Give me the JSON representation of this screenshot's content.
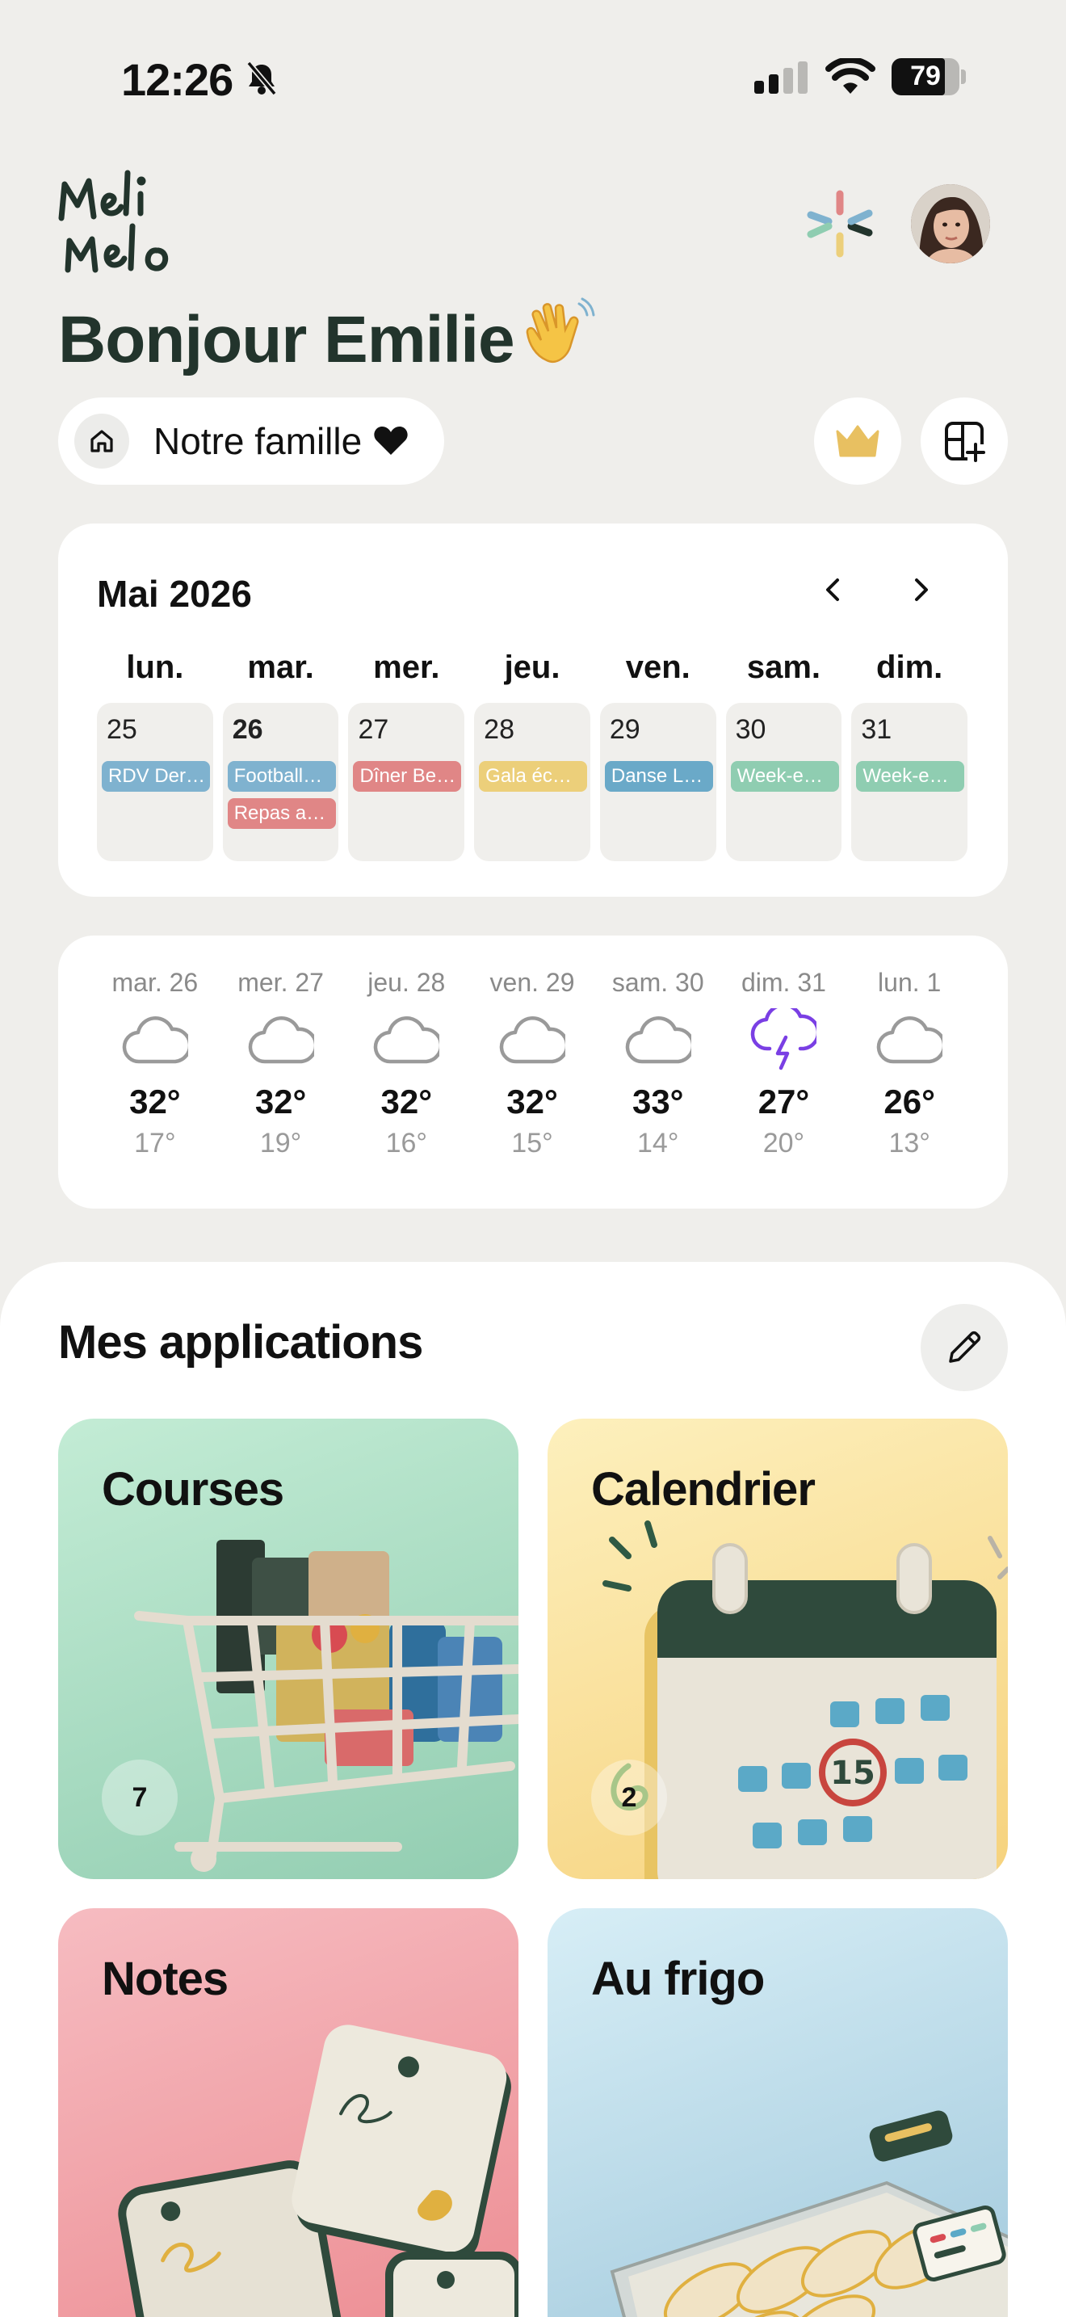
{
  "status": {
    "time": "12:26",
    "battery": "79"
  },
  "header": {
    "greeting": "Bonjour Emilie",
    "family": "Notre famille"
  },
  "calendar": {
    "month": "Mai 2026",
    "weekdays": [
      "lun.",
      "mar.",
      "mer.",
      "jeu.",
      "ven.",
      "sam.",
      "dim."
    ],
    "days": [
      {
        "num": "25",
        "events": [
          {
            "label": "RDV Der…",
            "color": "#7fb2cf"
          }
        ]
      },
      {
        "num": "26",
        "today": true,
        "events": [
          {
            "label": "Football…",
            "color": "#7fb2cf"
          },
          {
            "label": "Repas a…",
            "color": "#e08686"
          }
        ]
      },
      {
        "num": "27",
        "events": [
          {
            "label": "Dîner Be…",
            "color": "#e08686"
          }
        ]
      },
      {
        "num": "28",
        "events": [
          {
            "label": "Gala éc…",
            "color": "#eccf7a"
          }
        ]
      },
      {
        "num": "29",
        "events": [
          {
            "label": "Danse L…",
            "color": "#6aa9c8"
          }
        ]
      },
      {
        "num": "30",
        "events": [
          {
            "label": "Week-e…",
            "color": "#8fcdb1"
          }
        ]
      },
      {
        "num": "31",
        "events": [
          {
            "label": "Week-e…",
            "color": "#8fcdb1"
          }
        ]
      }
    ]
  },
  "weather": [
    {
      "day": "mar. 26",
      "high": "32°",
      "low": "17°",
      "icon": "cloud-icon"
    },
    {
      "day": "mer. 27",
      "high": "32°",
      "low": "19°",
      "icon": "cloud-icon"
    },
    {
      "day": "jeu. 28",
      "high": "32°",
      "low": "16°",
      "icon": "cloud-icon"
    },
    {
      "day": "ven. 29",
      "high": "32°",
      "low": "15°",
      "icon": "cloud-icon"
    },
    {
      "day": "sam. 30",
      "high": "33°",
      "low": "14°",
      "icon": "cloud-icon"
    },
    {
      "day": "dim. 31",
      "high": "27°",
      "low": "20°",
      "icon": "thunderstorm-icon"
    },
    {
      "day": "lun. 1",
      "high": "26°",
      "low": "13°",
      "icon": "cloud-icon"
    }
  ],
  "apps": {
    "title": "Mes applications",
    "tiles": [
      {
        "title": "Courses",
        "badge": "7"
      },
      {
        "title": "Calendrier",
        "badge": "2"
      },
      {
        "title": "Notes"
      },
      {
        "title": "Au frigo"
      }
    ]
  },
  "colors": {
    "dark_green": "#22342c",
    "storm_purple": "#7a3fe4"
  }
}
